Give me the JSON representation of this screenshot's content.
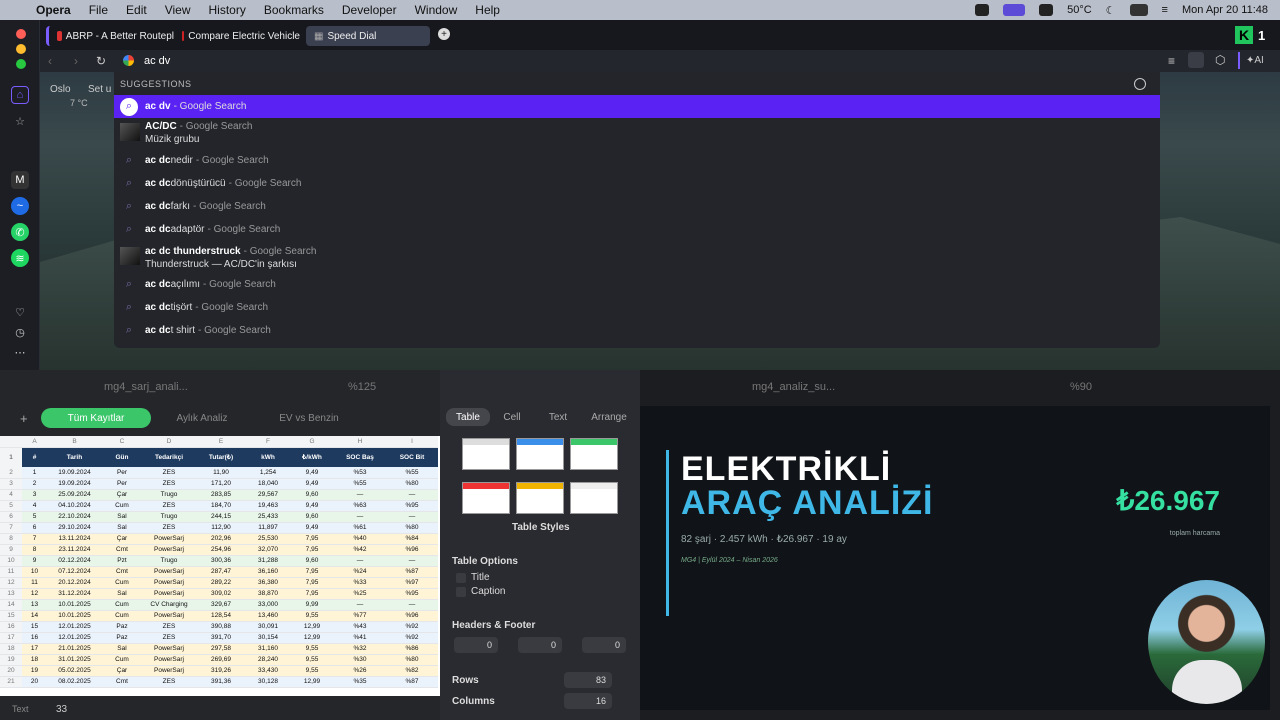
{
  "menubar": {
    "app": "Opera",
    "items": [
      "File",
      "Edit",
      "View",
      "History",
      "Bookmarks",
      "Developer",
      "Window",
      "Help"
    ],
    "temperature": "50°C",
    "clock": "Mon Apr 20  11:48"
  },
  "tabs": [
    {
      "label": "ABRP - A Better Routepl"
    },
    {
      "label": "Compare Electric Vehicle"
    },
    {
      "label": "Speed Dial"
    }
  ],
  "address": {
    "query": "ac dv"
  },
  "weather": {
    "city": "Oslo",
    "temp": "7 °C",
    "setup": "Set u"
  },
  "suggestions": {
    "header": "SUGGESTIONS",
    "google": "- Google Search",
    "items": [
      {
        "bold": "ac dv",
        "rest": ""
      },
      {
        "bold": "AC/DC",
        "rest": "",
        "sub": "Müzik grubu"
      },
      {
        "bold": "ac dc ",
        "rest": "nedir"
      },
      {
        "bold": "ac dc ",
        "rest": "dönüştürücü"
      },
      {
        "bold": "ac dc ",
        "rest": "farkı"
      },
      {
        "bold": "ac dc ",
        "rest": "adaptör"
      },
      {
        "bold": "ac dc thunderstruck",
        "rest": "",
        "sub": "Thunderstruck — AC/DC'in şarkısı"
      },
      {
        "bold": "ac dc ",
        "rest": "açılımı"
      },
      {
        "bold": "ac dc ",
        "rest": "tişört"
      },
      {
        "bold": "ac dc ",
        "rest": "t shirt"
      }
    ]
  },
  "sheet": {
    "title": "mg4_sarj_anali...",
    "zoom": "%125",
    "tabs": [
      "Tüm Kayıtlar",
      "Aylık Analiz",
      "EV vs Benzin"
    ],
    "col_letters": [
      "A",
      "B",
      "C",
      "D",
      "E",
      "F",
      "G",
      "H",
      "I"
    ],
    "headers": [
      "#",
      "Tarih",
      "Gün",
      "Tedarikçi",
      "Tutar(₺)",
      "kWh",
      "₺/kWh",
      "SOC Baş",
      "SOC Bit"
    ],
    "rows": [
      [
        "1",
        "19.09.2024",
        "Per",
        "ZES",
        "11,90",
        "1,254",
        "9,49",
        "%53",
        "%55"
      ],
      [
        "2",
        "19.09.2024",
        "Per",
        "ZES",
        "171,20",
        "18,040",
        "9,49",
        "%55",
        "%80"
      ],
      [
        "3",
        "25.09.2024",
        "Çar",
        "Trugo",
        "283,85",
        "29,567",
        "9,60",
        "—",
        "—"
      ],
      [
        "4",
        "04.10.2024",
        "Cum",
        "ZES",
        "184,70",
        "19,463",
        "9,49",
        "%63",
        "%95"
      ],
      [
        "5",
        "22.10.2024",
        "Sal",
        "Trugo",
        "244,15",
        "25,433",
        "9,60",
        "—",
        "—"
      ],
      [
        "6",
        "29.10.2024",
        "Sal",
        "ZES",
        "112,90",
        "11,897",
        "9,49",
        "%61",
        "%80"
      ],
      [
        "7",
        "13.11.2024",
        "Çar",
        "PowerSarj",
        "202,96",
        "25,530",
        "7,95",
        "%40",
        "%84"
      ],
      [
        "8",
        "23.11.2024",
        "Cmt",
        "PowerSarj",
        "254,96",
        "32,070",
        "7,95",
        "%42",
        "%96"
      ],
      [
        "9",
        "02.12.2024",
        "Pzt",
        "Trugo",
        "300,36",
        "31,288",
        "9,60",
        "—",
        "—"
      ],
      [
        "10",
        "07.12.2024",
        "Cmt",
        "PowerSarj",
        "287,47",
        "36,160",
        "7,95",
        "%24",
        "%87"
      ],
      [
        "11",
        "20.12.2024",
        "Cum",
        "PowerSarj",
        "289,22",
        "36,380",
        "7,95",
        "%33",
        "%97"
      ],
      [
        "12",
        "31.12.2024",
        "Sal",
        "PowerSarj",
        "309,02",
        "38,870",
        "7,95",
        "%25",
        "%95"
      ],
      [
        "13",
        "10.01.2025",
        "Cum",
        "CV Charging",
        "329,67",
        "33,000",
        "9,99",
        "—",
        "—"
      ],
      [
        "14",
        "10.01.2025",
        "Cum",
        "PowerSarj",
        "128,54",
        "13,460",
        "9,55",
        "%77",
        "%96"
      ],
      [
        "15",
        "12.01.2025",
        "Paz",
        "ZES",
        "390,88",
        "30,091",
        "12,99",
        "%43",
        "%92"
      ],
      [
        "16",
        "12.01.2025",
        "Paz",
        "ZES",
        "391,70",
        "30,154",
        "12,99",
        "%41",
        "%92"
      ],
      [
        "17",
        "21.01.2025",
        "Sal",
        "PowerSarj",
        "297,58",
        "31,160",
        "9,55",
        "%32",
        "%86"
      ],
      [
        "18",
        "31.01.2025",
        "Cum",
        "PowerSarj",
        "269,69",
        "28,240",
        "9,55",
        "%30",
        "%80"
      ],
      [
        "19",
        "05.02.2025",
        "Çar",
        "PowerSarj",
        "319,26",
        "33,430",
        "9,55",
        "%26",
        "%82"
      ],
      [
        "20",
        "08.02.2025",
        "Cmt",
        "ZES",
        "391,36",
        "30,128",
        "12,99",
        "%35",
        "%87"
      ]
    ],
    "footer_label": "Text",
    "footer_value": "33"
  },
  "inspector": {
    "tabs": [
      "Table",
      "Cell",
      "Text",
      "Arrange"
    ],
    "styles_label": "Table Styles",
    "options_label": "Table Options",
    "title_opt": "Title",
    "caption_opt": "Caption",
    "hf_label": "Headers & Footer",
    "hf_values": [
      "0",
      "0",
      "0"
    ],
    "rows_label": "Rows",
    "rows_value": "83",
    "cols_label": "Columns",
    "cols_value": "16"
  },
  "slides": {
    "title": "mg4_analiz_su...",
    "zoom": "%90",
    "line1": "ELEKTRİKLİ",
    "line2": "ARAÇ ANALİZİ",
    "stats": "82 şarj  ·  2.457 kWh  ·  ₺26.967  ·  19 ay",
    "sub": "MG4  |  Eylül 2024 – Nisan 2026",
    "big": "₺26.967",
    "big_label": "toplam harcama"
  }
}
